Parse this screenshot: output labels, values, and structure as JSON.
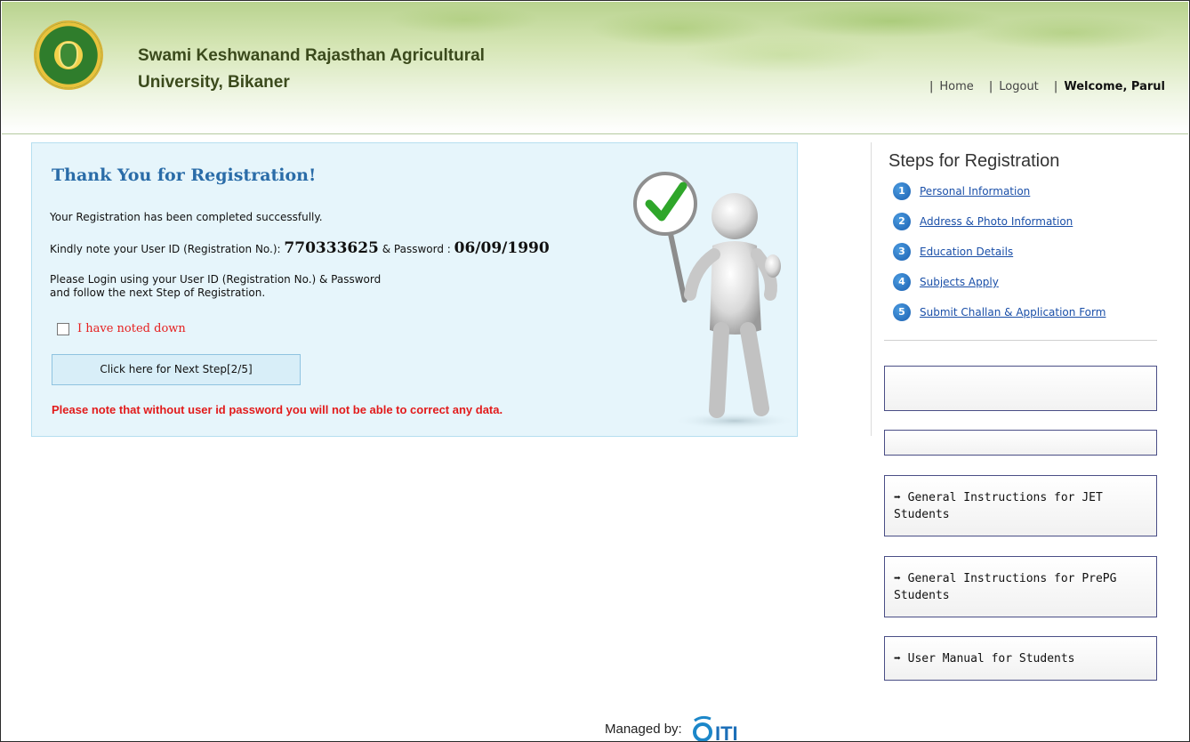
{
  "header": {
    "university_line1": "Swami Keshwanand Rajasthan Agricultural",
    "university_line2": "University, Bikaner",
    "nav": {
      "sep": "|",
      "home": "Home",
      "logout": "Logout",
      "welcome": "Welcome, Parul"
    }
  },
  "main": {
    "title": "Thank You for Registration!",
    "line_completed": "Your Registration has been completed successfully.",
    "note_prefix": "Kindly note your User ID (Registration No.):",
    "user_id": "770333625",
    "password_label": "& Password :",
    "password": "06/09/1990",
    "login_line1": "Please Login using your User ID (Registration No.) & Password",
    "login_line2": "and follow the next Step of Registration.",
    "noted_label": "I have noted down",
    "next_button": "Click here for Next Step[2/5]",
    "warning": "Please note that without user id password you will not be able to correct any data."
  },
  "sidebar": {
    "steps_title": "Steps for Registration",
    "steps": [
      {
        "num": "1",
        "label": "Personal Information"
      },
      {
        "num": "2",
        "label": "Address & Photo Information"
      },
      {
        "num": "3",
        "label": "Education Details"
      },
      {
        "num": "4",
        "label": "Subjects Apply"
      },
      {
        "num": "5",
        "label": "Submit Challan & Application Form"
      }
    ],
    "buttons": [
      {
        "arrow": "➡",
        "label": "General Instructions for JET Students"
      },
      {
        "arrow": "➡",
        "label": "General Instructions for PrePG Students"
      },
      {
        "arrow": "➡",
        "label": "User Manual for Students"
      }
    ]
  },
  "footer": {
    "managed_by": "Managed by:",
    "logo_text": "ITI"
  },
  "colors": {
    "title_blue": "#2a6ca8",
    "warning_red": "#e21b1b",
    "panel_bg": "#e6f5fb",
    "link_blue": "#1a4fa8"
  }
}
